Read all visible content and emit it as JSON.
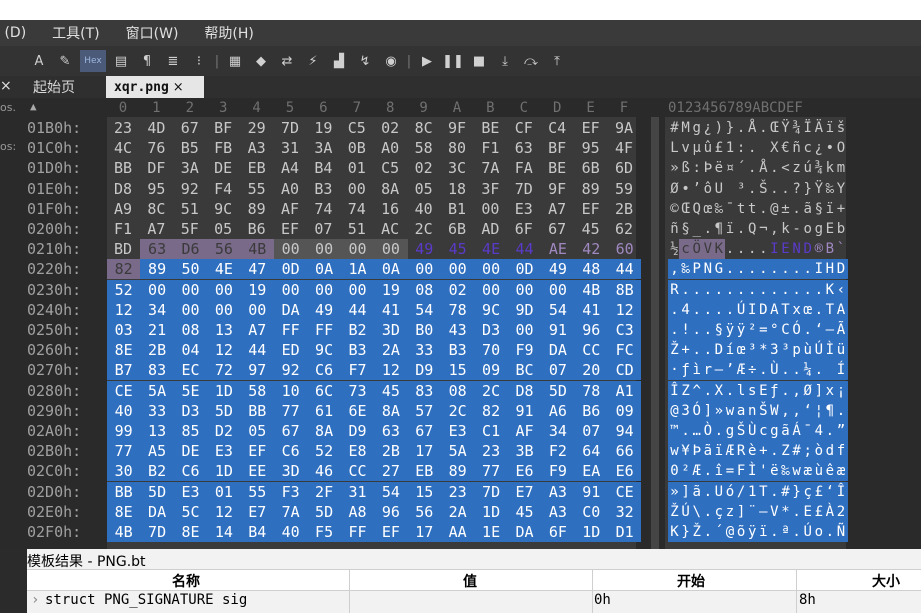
{
  "menu": [
    {
      "label": " (D)"
    },
    {
      "label": "工具(T)"
    },
    {
      "label": "窗口(W)"
    },
    {
      "label": "帮助(H)"
    }
  ],
  "toolbar": {
    "hex_label": "Hex",
    "icons": [
      "font-icon",
      "highlight-icon",
      "hex-icon",
      "columns-icon",
      "pilcrow-icon",
      "linewrap-icon",
      "binary-icon",
      "separator",
      "calculator-icon",
      "bookmark-icon",
      "compare-icon",
      "histogram-icon",
      "chart-icon",
      "checksum-icon",
      "hash-icon",
      "separator",
      "run-icon",
      "pause-icon",
      "stop-icon",
      "step-into-icon",
      "step-over-icon",
      "step-out-icon"
    ]
  },
  "tabs": {
    "close_left": "×",
    "home": "起始页",
    "active": "xqr.png",
    "active_close": "×"
  },
  "edge_labels": [
    "os.",
    "os:"
  ],
  "column_headers": [
    "0",
    "1",
    "2",
    "3",
    "4",
    "5",
    "6",
    "7",
    "8",
    "9",
    "A",
    "B",
    "C",
    "D",
    "E",
    "F"
  ],
  "ascii_header": "0123456789ABCDEF",
  "rows": [
    {
      "addr": "01B0h:",
      "bytes": [
        "23",
        "4D",
        "67",
        "BF",
        "29",
        "7D",
        "19",
        "C5",
        "02",
        "8C",
        "9F",
        "BE",
        "CF",
        "C4",
        "EF",
        "9A"
      ],
      "ascii": "#Mg¿)}.Å.ŒŸ¾ÏÄïš"
    },
    {
      "addr": "01C0h:",
      "bytes": [
        "4C",
        "76",
        "B5",
        "FB",
        "A3",
        "31",
        "3A",
        "0B",
        "A0",
        "58",
        "80",
        "F1",
        "63",
        "BF",
        "95",
        "4F"
      ],
      "ascii": "Lvµû£1:. X€ñc¿•O"
    },
    {
      "addr": "01D0h:",
      "bytes": [
        "BB",
        "DF",
        "3A",
        "DE",
        "EB",
        "A4",
        "B4",
        "01",
        "C5",
        "02",
        "3C",
        "7A",
        "FA",
        "BE",
        "6B",
        "6D"
      ],
      "ascii": "»ß:Þë¤´.Å.<zú¾km"
    },
    {
      "addr": "01E0h:",
      "bytes": [
        "D8",
        "95",
        "92",
        "F4",
        "55",
        "A0",
        "B3",
        "00",
        "8A",
        "05",
        "18",
        "3F",
        "7D",
        "9F",
        "89",
        "59"
      ],
      "ascii": "Ø•’ôU ³.Š..?}Ÿ‰Y"
    },
    {
      "addr": "01F0h:",
      "bytes": [
        "A9",
        "8C",
        "51",
        "9C",
        "89",
        "AF",
        "74",
        "74",
        "16",
        "40",
        "B1",
        "00",
        "E3",
        "A7",
        "EF",
        "2B"
      ],
      "ascii": "©ŒQœ‰¯tt.@±.ã§ï+"
    },
    {
      "addr": "0200h:",
      "bytes": [
        "F1",
        "A7",
        "5F",
        "05",
        "B6",
        "EF",
        "07",
        "51",
        "AC",
        "2C",
        "6B",
        "AD",
        "6F",
        "67",
        "45",
        "62"
      ],
      "ascii": "ñ§_.¶ï.Q¬,k-ogEb"
    },
    {
      "addr": "0210h:",
      "bytes": [
        "BD",
        "63",
        "D6",
        "56",
        "4B",
        "00",
        "00",
        "00",
        "00",
        "49",
        "45",
        "4E",
        "44",
        "AE",
        "42",
        "60"
      ],
      "ascii": "½cÖVK....IEND®B`"
    },
    {
      "addr": "0220h:",
      "bytes": [
        "82",
        "89",
        "50",
        "4E",
        "47",
        "0D",
        "0A",
        "1A",
        "0A",
        "00",
        "00",
        "00",
        "0D",
        "49",
        "48",
        "44"
      ],
      "ascii": ",‰PNG........IHD"
    },
    {
      "addr": "0230h:",
      "bytes": [
        "52",
        "00",
        "00",
        "00",
        "19",
        "00",
        "00",
        "00",
        "19",
        "08",
        "02",
        "00",
        "00",
        "00",
        "4B",
        "8B"
      ],
      "ascii": "R.............K‹"
    },
    {
      "addr": "0240h:",
      "bytes": [
        "12",
        "34",
        "00",
        "00",
        "00",
        "DA",
        "49",
        "44",
        "41",
        "54",
        "78",
        "9C",
        "9D",
        "54",
        "41",
        "12"
      ],
      "ascii": ".4....ÚIDATxœ.TA."
    },
    {
      "addr": "0250h:",
      "bytes": [
        "03",
        "21",
        "08",
        "13",
        "A7",
        "FF",
        "FF",
        "B2",
        "3D",
        "B0",
        "43",
        "D3",
        "00",
        "91",
        "96",
        "C3"
      ],
      "ascii": ".!..§ÿÿ²=°CÓ.‘–Ã"
    },
    {
      "addr": "0260h:",
      "bytes": [
        "8E",
        "2B",
        "04",
        "12",
        "44",
        "ED",
        "9C",
        "B3",
        "2A",
        "33",
        "B3",
        "70",
        "F9",
        "DA",
        "CC",
        "FC"
      ],
      "ascii": "Ž+..Díœ³*3³pùÚÌü"
    },
    {
      "addr": "0270h:",
      "bytes": [
        "B7",
        "83",
        "EC",
        "72",
        "97",
        "92",
        "C6",
        "F7",
        "12",
        "D9",
        "15",
        "09",
        "BC",
        "07",
        "20",
        "CD"
      ],
      "ascii": "·ƒìr—’Æ÷.Ù..¼. Í"
    },
    {
      "addr": "0280h:",
      "bytes": [
        "CE",
        "5A",
        "5E",
        "1D",
        "58",
        "10",
        "6C",
        "73",
        "45",
        "83",
        "08",
        "2C",
        "D8",
        "5D",
        "78",
        "A1"
      ],
      "ascii": "ÎZ^.X.lsEƒ.,Ø]x¡"
    },
    {
      "addr": "0290h:",
      "bytes": [
        "40",
        "33",
        "D3",
        "5D",
        "BB",
        "77",
        "61",
        "6E",
        "8A",
        "57",
        "2C",
        "82",
        "91",
        "A6",
        "B6",
        "09"
      ],
      "ascii": "@3Ó]»wanŠW,‚‘¦¶."
    },
    {
      "addr": "02A0h:",
      "bytes": [
        "99",
        "13",
        "85",
        "D2",
        "05",
        "67",
        "8A",
        "D9",
        "63",
        "67",
        "E3",
        "C1",
        "AF",
        "34",
        "07",
        "94"
      ],
      "ascii": "™.…Ò.gŠÙcgãÁ¯4.”"
    },
    {
      "addr": "02B0h:",
      "bytes": [
        "77",
        "A5",
        "DE",
        "E3",
        "EF",
        "C6",
        "52",
        "E8",
        "2B",
        "17",
        "5A",
        "23",
        "3B",
        "F2",
        "64",
        "66"
      ],
      "ascii": "w¥ÞãïÆRè+.Z#;òdf"
    },
    {
      "addr": "02C0h:",
      "bytes": [
        "30",
        "B2",
        "C6",
        "1D",
        "EE",
        "3D",
        "46",
        "CC",
        "27",
        "EB",
        "89",
        "77",
        "E6",
        "F9",
        "EA",
        "E6"
      ],
      "ascii": "0²Æ.î=FÌ'ë‰wæùêæ"
    },
    {
      "addr": "02D0h:",
      "bytes": [
        "BB",
        "5D",
        "E3",
        "01",
        "55",
        "F3",
        "2F",
        "31",
        "54",
        "15",
        "23",
        "7D",
        "E7",
        "A3",
        "91",
        "CE"
      ],
      "ascii": "»]ã.Uó/1T.#}ç£‘Î"
    },
    {
      "addr": "02E0h:",
      "bytes": [
        "8E",
        "DA",
        "5C",
        "12",
        "E7",
        "7A",
        "5D",
        "A8",
        "96",
        "56",
        "2A",
        "1D",
        "45",
        "A3",
        "C0",
        "32"
      ],
      "ascii": "ŽÚ\\.çz]¨–V*.E£À2"
    },
    {
      "addr": "02F0h:",
      "bytes": [
        "4B",
        "7D",
        "8E",
        "14",
        "B4",
        "40",
        "F5",
        "FF",
        "EF",
        "17",
        "AA",
        "1E",
        "DA",
        "6F",
        "1D",
        "D1"
      ],
      "ascii": "K}Ž.´@õÿï.ª.Úo.Ñ"
    }
  ],
  "template": {
    "title": "模板结果 - PNG.bt",
    "headers": {
      "name": "名称",
      "value": "值",
      "start": "开始",
      "size": "大小"
    },
    "rows": [
      {
        "expander": "›",
        "name": "struct PNG_SIGNATURE sig",
        "value": "",
        "start": "0h",
        "size": "8h"
      }
    ]
  }
}
